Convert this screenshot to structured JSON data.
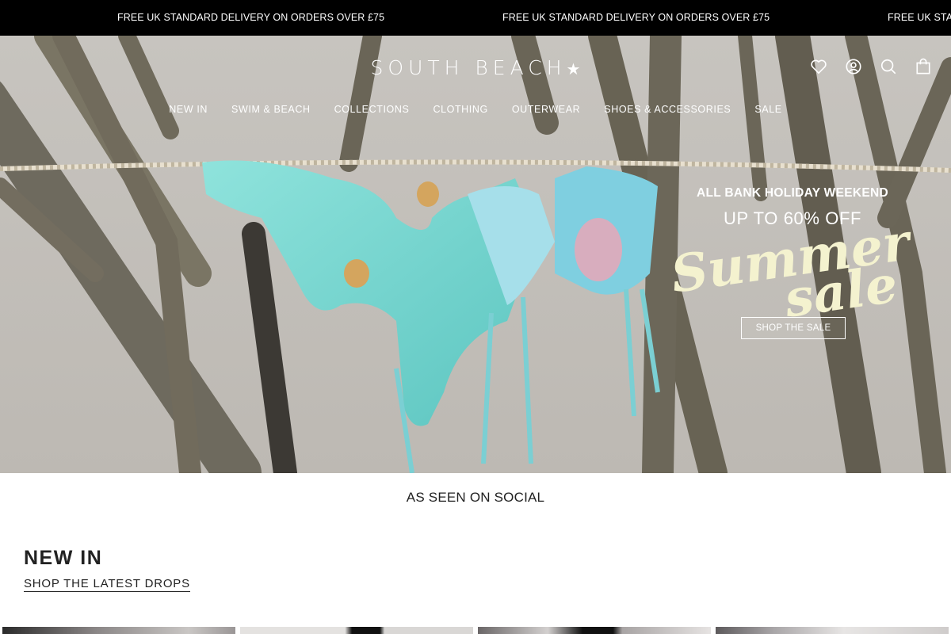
{
  "announcement": {
    "messages": [
      "FREE UK STANDARD DELIVERY ON ORDERS OVER £75",
      "FREE UK STANDARD DELIVERY ON ORDERS OVER £75",
      "FREE UK STAND"
    ]
  },
  "header": {
    "logo": "SOUTH BEACH",
    "logo_star": "★",
    "icons": [
      "heart-icon",
      "account-icon",
      "search-icon",
      "bag-icon"
    ]
  },
  "nav": {
    "items": [
      "NEW IN",
      "SWIM & BEACH",
      "COLLECTIONS",
      "CLOTHING",
      "OUTERWEAR",
      "SHOES & ACCESSORIES",
      "SALE"
    ]
  },
  "hero": {
    "line1": "ALL BANK HOLIDAY WEEKEND",
    "line2": "UP TO 60% OFF",
    "script_word1": "Summer",
    "script_word2": "sale",
    "cta": "SHOP THE SALE"
  },
  "social": {
    "title": "AS SEEN ON SOCIAL"
  },
  "new_in": {
    "title": "NEW IN",
    "link": "SHOP THE LATEST DROPS"
  },
  "colors": {
    "announcement_bg": "#000000",
    "hero_text": "#ffffff",
    "script_text": "#f4f2cf",
    "swim_aqua": "#79d6cf"
  }
}
